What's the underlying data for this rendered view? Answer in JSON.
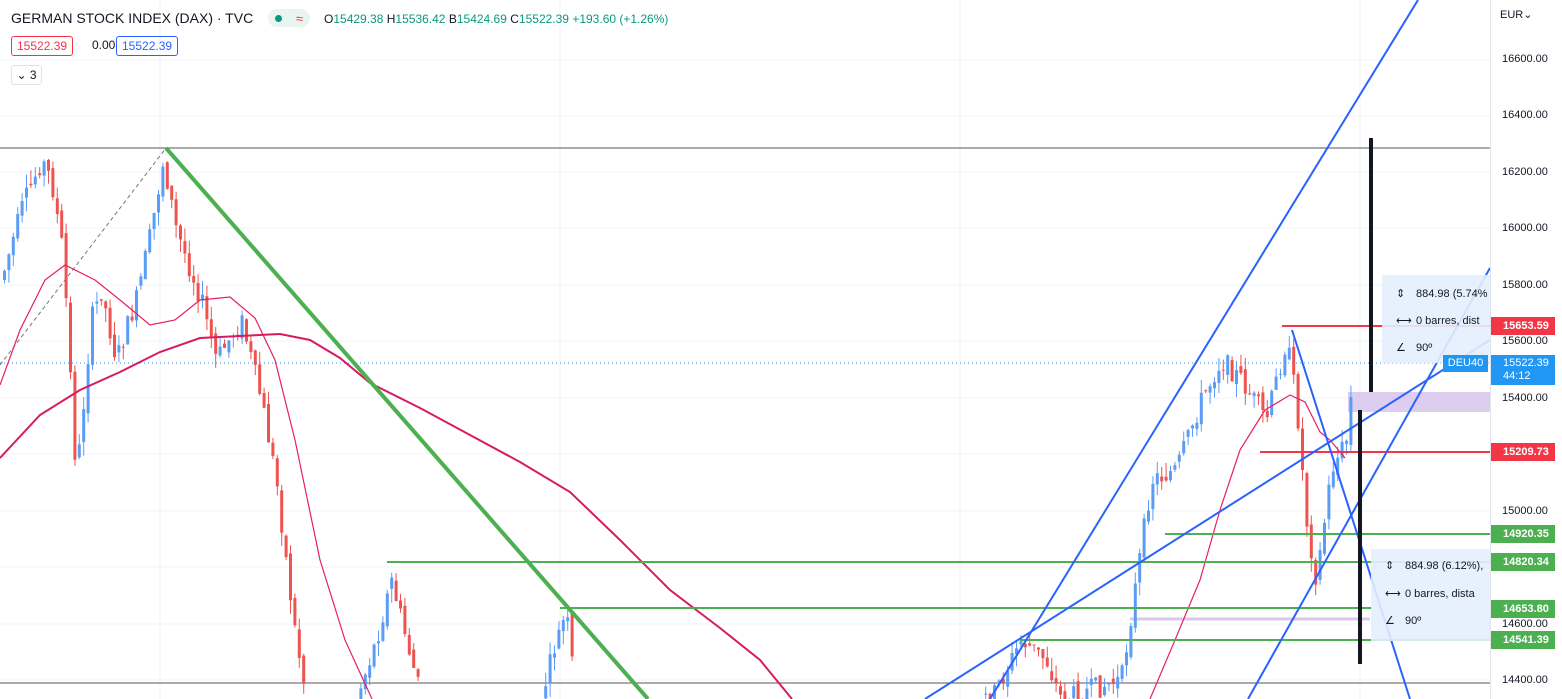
{
  "header": {
    "symbol_title": "GERMAN STOCK INDEX (DAX) · TVC",
    "wave_symbol": "≈",
    "ohlc": {
      "o_label": "O",
      "o": "15429.38",
      "h_label": "H",
      "h": "15536.42",
      "b_label": "B",
      "b": "15424.69",
      "c_label": "C",
      "c": "15522.39",
      "change": "+193.60 (+1.26%)"
    },
    "bid": "15522.39",
    "spread": "0.00",
    "ask": "15522.39",
    "indicator_count": "3",
    "collapse_icon": "chevron-down-icon"
  },
  "price_axis": {
    "currency": "EUR",
    "ticks": [
      "16600.00",
      "16400.00",
      "16200.00",
      "16000.00",
      "15800.00",
      "15600.00",
      "15400.00",
      "15000.00",
      "14600.00",
      "14400.00"
    ]
  },
  "price_labels": [
    {
      "value": "15653.59",
      "color": "#f23645"
    },
    {
      "value": "15209.73",
      "color": "#f23645"
    },
    {
      "value": "14920.35",
      "color": "#4caf50"
    },
    {
      "value": "14820.34",
      "color": "#4caf50"
    },
    {
      "value": "14653.80",
      "color": "#4caf50"
    },
    {
      "value": "14541.39",
      "color": "#4caf50"
    }
  ],
  "current_price": {
    "symbol": "DEU40",
    "value": "15522.39",
    "countdown": "44:12"
  },
  "measure_boxes": [
    {
      "range": "884.98 (5.74%",
      "bars": "0 barres, dist",
      "angle": "90º"
    },
    {
      "range": "884.98 (6.12%),",
      "bars": "0 barres, dista",
      "angle": "90º"
    }
  ],
  "colors": {
    "up": "#5b9cf6",
    "down": "#ef5350",
    "ma_fast": "#e91e63",
    "ma_slow": "#d81b60",
    "trend_green": "#4caf50",
    "channel_blue": "#2962ff",
    "accent_blue": "#2196f3"
  }
}
